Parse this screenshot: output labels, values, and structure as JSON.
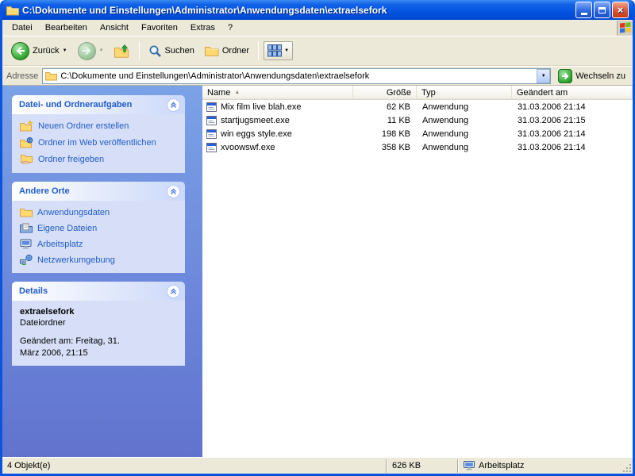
{
  "window": {
    "title": "C:\\Dokumente und Einstellungen\\Administrator\\Anwendungsdaten\\extraelsefork"
  },
  "menu": {
    "items": [
      "Datei",
      "Bearbeiten",
      "Ansicht",
      "Favoriten",
      "Extras",
      "?"
    ]
  },
  "toolbar": {
    "back_label": "Zurück",
    "search_label": "Suchen",
    "folders_label": "Ordner"
  },
  "address": {
    "label": "Adresse",
    "value": "C:\\Dokumente und Einstellungen\\Administrator\\Anwendungsdaten\\extraelsefork",
    "go_label": "Wechseln zu"
  },
  "sidebar": {
    "panels": [
      {
        "title": "Datei- und Ordneraufgaben",
        "items": [
          {
            "label": "Neuen Ordner erstellen"
          },
          {
            "label": "Ordner im Web veröffentlichen"
          },
          {
            "label": "Ordner freigeben"
          }
        ]
      },
      {
        "title": "Andere Orte",
        "items": [
          {
            "label": "Anwendungsdaten"
          },
          {
            "label": "Eigene Dateien"
          },
          {
            "label": "Arbeitsplatz"
          },
          {
            "label": "Netzwerkumgebung"
          }
        ]
      },
      {
        "title": "Details",
        "details": {
          "name": "extraelsefork",
          "type": "Dateiordner",
          "modified": "Geändert am: Freitag, 31. März 2006, 21:15"
        }
      }
    ]
  },
  "filelist": {
    "columns": [
      "Name",
      "Größe",
      "Typ",
      "Geändert am"
    ],
    "files": [
      {
        "name": "Mix film live blah.exe",
        "size": "62 KB",
        "type": "Anwendung",
        "modified": "31.03.2006 21:14"
      },
      {
        "name": "startjugsmeet.exe",
        "size": "11 KB",
        "type": "Anwendung",
        "modified": "31.03.2006 21:15"
      },
      {
        "name": "win eggs style.exe",
        "size": "198 KB",
        "type": "Anwendung",
        "modified": "31.03.2006 21:14"
      },
      {
        "name": "xvoowswf.exe",
        "size": "358 KB",
        "type": "Anwendung",
        "modified": "31.03.2006 21:14"
      }
    ]
  },
  "status": {
    "objects": "4 Objekt(e)",
    "size": "626 KB",
    "location": "Arbeitsplatz"
  }
}
